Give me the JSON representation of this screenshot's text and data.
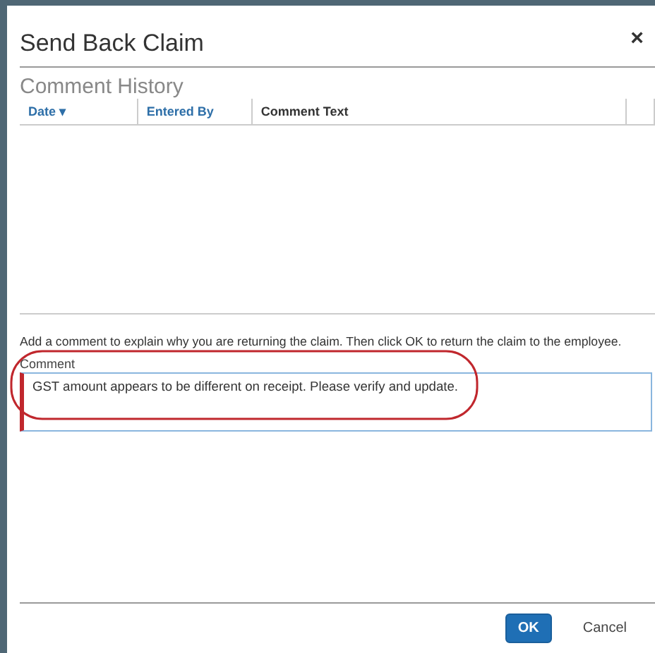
{
  "dialog": {
    "title": "Send Back Claim",
    "close": "×"
  },
  "history": {
    "heading": "Comment History",
    "columns": [
      {
        "label": "Date",
        "sort_indicator": "▾",
        "link": true
      },
      {
        "label": "Entered By",
        "link": true
      },
      {
        "label": "Comment Text",
        "link": false
      }
    ]
  },
  "instruction": "Add a comment to explain why you are returning the claim. Then click OK to return the claim to the employee.",
  "comment": {
    "label": "Comment",
    "value": "GST amount appears to be different on receipt. Please verify and update.",
    "required": true
  },
  "buttons": [
    {
      "label": "OK",
      "kind": "primary"
    },
    {
      "label": "Cancel",
      "kind": "link"
    }
  ]
}
